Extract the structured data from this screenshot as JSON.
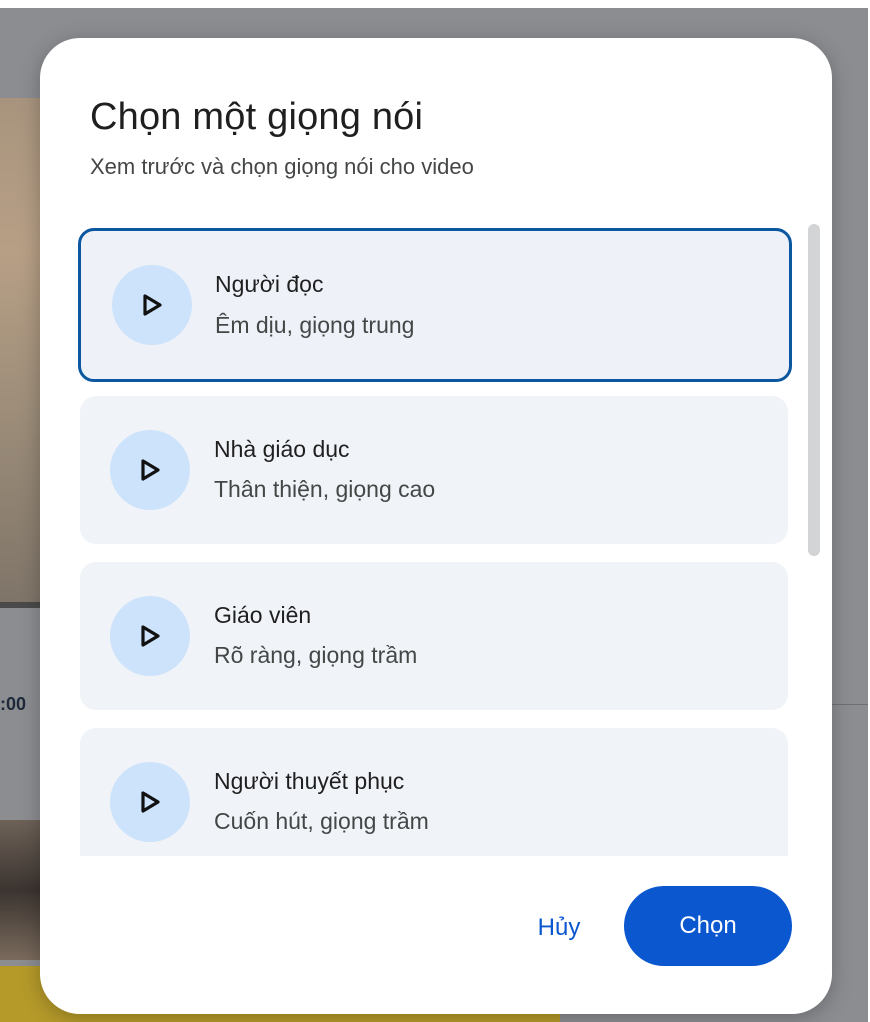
{
  "dialog": {
    "title": "Chọn một giọng nói",
    "subtitle": "Xem trước và chọn giọng nói cho video",
    "cancel_label": "Hủy",
    "select_label": "Chọn"
  },
  "voices": [
    {
      "name": "Người đọc",
      "description": "Êm dịu, giọng trung",
      "selected": true
    },
    {
      "name": "Nhà giáo dục",
      "description": "Thân thiện, giọng cao",
      "selected": false
    },
    {
      "name": "Giáo viên",
      "description": "Rõ ràng, giọng trầm",
      "selected": false
    },
    {
      "name": "Người thuyết phục",
      "description": "Cuốn hút, giọng trầm",
      "selected": false
    }
  ],
  "background": {
    "time_fragment": ":00"
  },
  "icons": {
    "play": "play-icon"
  },
  "colors": {
    "accent": "#0b57d0",
    "selected_border": "#0b57a0",
    "card_bg": "#f0f3f8",
    "play_bg": "#cde3fb"
  }
}
